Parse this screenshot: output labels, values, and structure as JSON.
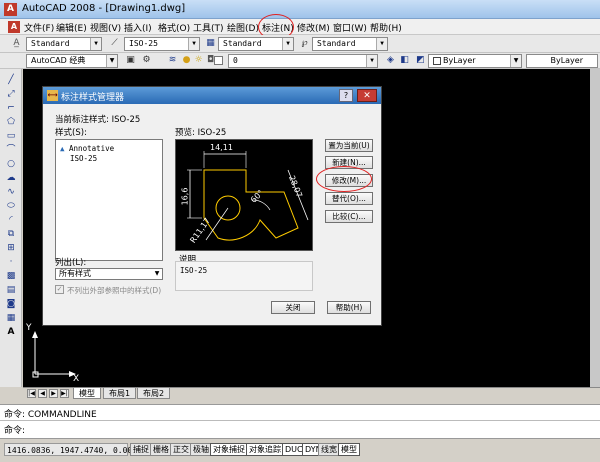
{
  "app": {
    "title": "AutoCAD 2008 - [Drawing1.dwg]",
    "logo": "A"
  },
  "menu": [
    "文件(F)",
    "编辑(E)",
    "视图(V)",
    "插入(I)",
    "格式(O)",
    "工具(T)",
    "绘图(D)",
    "标注(N)",
    "修改(M)",
    "窗口(W)",
    "帮助(H)"
  ],
  "toolbar1": {
    "text_style": "Standard",
    "dim_style": "ISO-25",
    "table_style": "Standard",
    "multileader_style": "Standard"
  },
  "toolbar2": {
    "workspace": "AutoCAD 经典",
    "layer": "0",
    "color": "ByLayer",
    "linetype": "ByLayer"
  },
  "canvas": {
    "axis_y": "Y",
    "axis_x": "X"
  },
  "tabs": [
    "模型",
    "布局1",
    "布局2"
  ],
  "command": {
    "line1": "命令: COMMANDLINE",
    "line2": "命令:"
  },
  "status": {
    "coords": "1416.0836, 1947.4740, 0.0000",
    "buttons": [
      "捕捉",
      "栅格",
      "正交",
      "极轴",
      "对象捕捉",
      "对象追踪",
      "DUCS",
      "DYN",
      "线宽",
      "模型"
    ]
  },
  "dialog": {
    "title": "标注样式管理器",
    "current_label": "当前标注样式: ISO-25",
    "styles_label": "样式(S):",
    "styles": [
      "Annotative",
      "ISO-25"
    ],
    "list_label": "列出(L):",
    "list_value": "所有样式",
    "checkbox_label": "不列出外部参照中的样式(D)",
    "preview_label": "预览: ISO-25",
    "desc_label": "说明",
    "desc_value": "ISO-25",
    "buttons": {
      "set_current": "置为当前(U)",
      "new": "新建(N)...",
      "modify": "修改(M)...",
      "override": "替代(O)...",
      "compare": "比较(C)...",
      "close": "关闭",
      "help": "帮助(H)"
    },
    "preview_dims": {
      "top": "14,11",
      "left": "16,6",
      "right": "28,07",
      "angle": "60°",
      "radius": "R11,17"
    }
  },
  "colors": {
    "annotation": "#e02020",
    "dialog_title": "#2a6ab5",
    "canvas": "#000000",
    "preview_geometry": "#ffcc00"
  }
}
